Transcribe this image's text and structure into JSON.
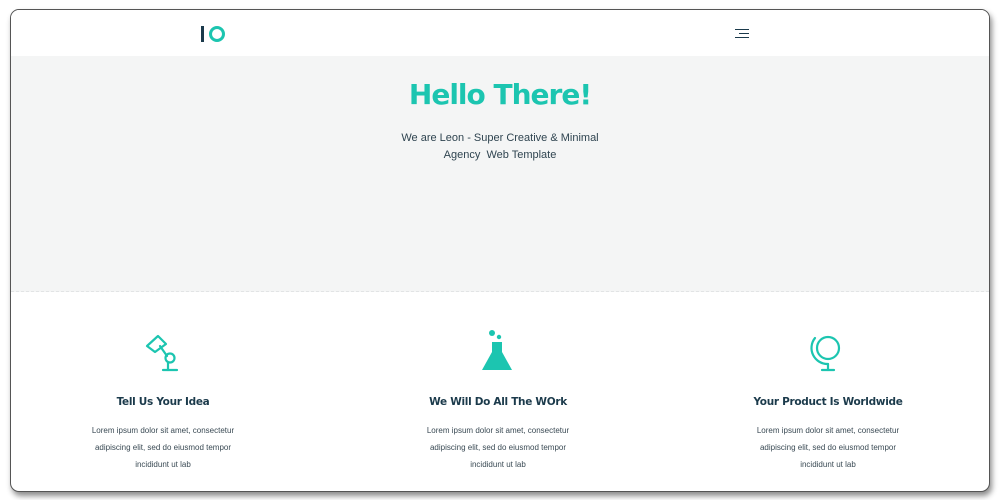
{
  "header": {
    "logo_icon": "logo-mark",
    "menu_icon": "hamburger-menu-icon"
  },
  "hero": {
    "title": "Hello There!",
    "subtitle_line1": "We are Leon - Super Creative & Minimal",
    "subtitle_line2": "Agency  Web Template"
  },
  "features": [
    {
      "icon": "desk-lamp-icon",
      "title": "Tell Us Your Idea",
      "line1": "Lorem ipsum dolor sit amet, consectetur",
      "line2": "adipiscing elit, sed do eiusmod tempor",
      "line3": "incididunt ut lab"
    },
    {
      "icon": "flask-icon",
      "title": "We Will Do All The WOrk",
      "line1": "Lorem ipsum dolor sit amet, consectetur",
      "line2": "adipiscing elit, sed do eiusmod tempor",
      "line3": "incididunt ut lab"
    },
    {
      "icon": "globe-icon",
      "title": "Your Product Is Worldwide",
      "line1": "Lorem ipsum dolor sit amet, consectetur",
      "line2": "adipiscing elit, sed do eiusmod tempor",
      "line3": "incididunt ut lab"
    }
  ],
  "colors": {
    "accent": "#1cc5b0",
    "dark": "#1b3a4b",
    "hero_bg": "#f4f5f5"
  }
}
